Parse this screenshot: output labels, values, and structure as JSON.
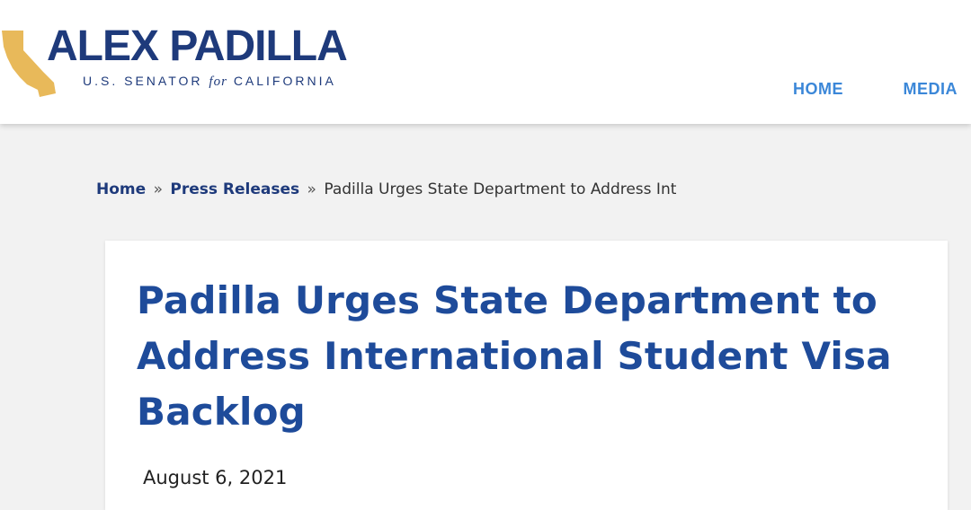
{
  "header": {
    "logo": {
      "name": "ALEX PADILLA",
      "subtitle_pre": "U.S. SENATOR",
      "subtitle_for": "for",
      "subtitle_post": "CALIFORNIA",
      "icon": "california-state-icon",
      "name_color": "#1e3a7b",
      "icon_color": "#e8b95a"
    },
    "nav": {
      "items": [
        {
          "label": "HOME"
        },
        {
          "label": "MEDIA"
        }
      ],
      "color": "#3b87d8"
    }
  },
  "breadcrumb": {
    "home": "Home",
    "sep": "»",
    "section": "Press Releases",
    "current": "Padilla Urges State Department to Address Int"
  },
  "article": {
    "title": "Padilla Urges State Department to Address International Student Visa Backlog",
    "date": "August 6, 2021",
    "title_color": "#1e4b9a"
  }
}
